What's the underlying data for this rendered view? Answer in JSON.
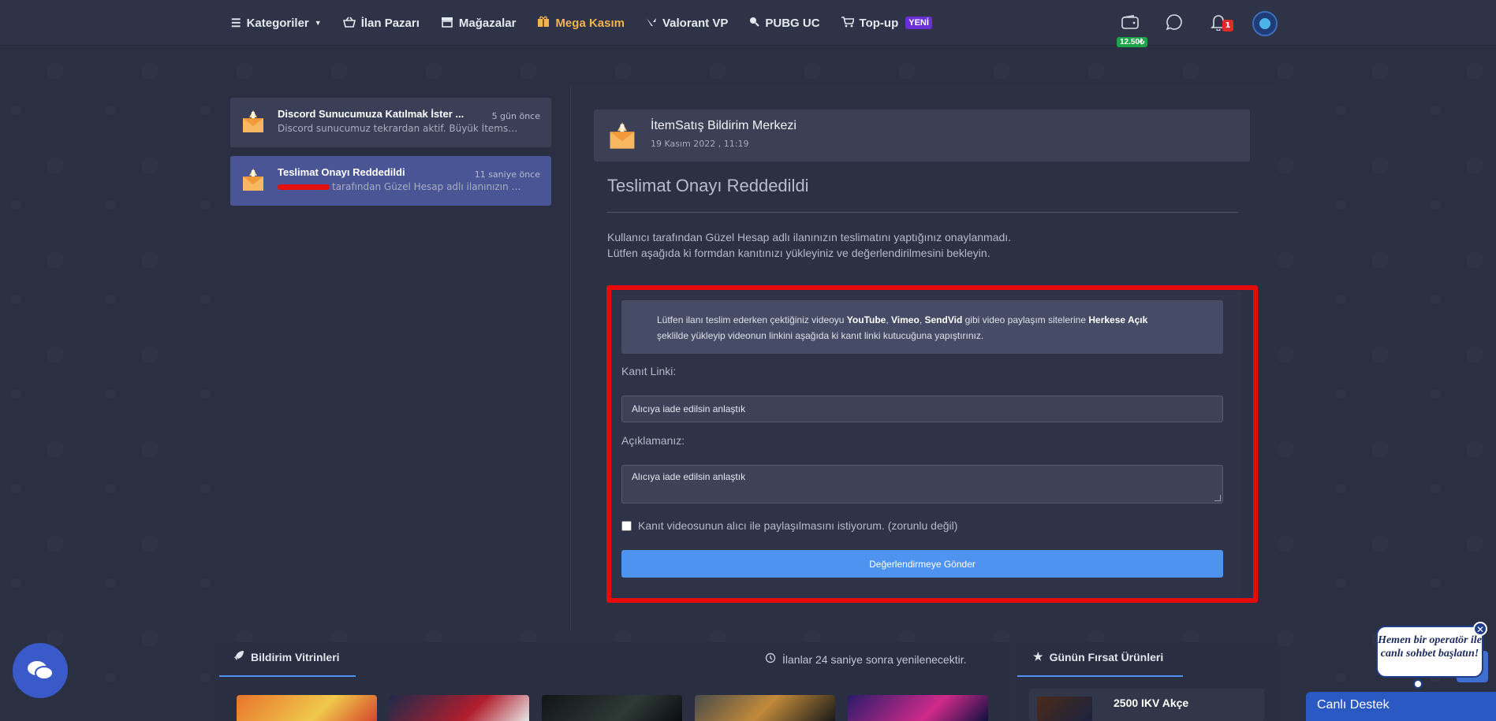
{
  "nav": {
    "items": [
      {
        "label": "Kategoriler",
        "icon": "list-icon",
        "has_dropdown": true
      },
      {
        "label": "İlan Pazarı",
        "icon": "basket-icon"
      },
      {
        "label": "Mağazalar",
        "icon": "store-icon"
      },
      {
        "label": "Mega Kasım",
        "icon": "gift-icon",
        "highlight": true
      },
      {
        "label": "Valorant VP",
        "icon": "valorant-icon"
      },
      {
        "label": "PUBG UC",
        "icon": "pubg-icon"
      },
      {
        "label": "Top-up",
        "icon": "cart-icon",
        "badge": "YENİ"
      }
    ],
    "wallet_amount": "12.50₺",
    "notification_count": "1",
    "highlight_color": "#f0b450"
  },
  "sidebar": {
    "messages": [
      {
        "title": "Discord Sunucumuza Katılmak İster ...",
        "time": "5 gün önce",
        "snippet": "Discord sunucumuz tekrardan aktif. Büyük İtemsat...",
        "active": false
      },
      {
        "title": "Teslimat Onayı Reddedildi",
        "time": "11 saniye önce",
        "snippet": "tarafından Güzel Hesap adlı ilanınızın t...",
        "active": true
      }
    ]
  },
  "notification": {
    "sender": "İtemSatış Bildirim Merkezi",
    "date": "19 Kasım 2022 , 11:19",
    "title": "Teslimat Onayı Reddedildi",
    "desc_line1": "Kullanıcı tarafından Güzel Hesap adlı ilanınızın teslimatını yaptığınız onaylanmadı.",
    "desc_line2": "Lütfen aşağıda ki formdan kanıtınızı yükleyiniz ve değerlendirilmesini bekleyin."
  },
  "form": {
    "info_prefix": "Lütfen ilanı teslim ederken çektiğiniz videoyu ",
    "info_yt": "YouTube",
    "info_sep1": ", ",
    "info_vimeo": "Vimeo",
    "info_sep2": ", ",
    "info_sendvid": "SendVid",
    "info_mid": " gibi video paylaşım sitelerine ",
    "info_public": "Herkese Açık",
    "info_suffix": "şeklilde yükleyip videonun linkini aşağıda ki kanıt linki kutucuğuna yapıştırınız.",
    "proof_label": "Kanıt Linki:",
    "proof_value": "Alıcıya iade edilsin anlaştık",
    "explain_label": "Açıklamanız:",
    "explain_value": "Alıcıya iade edilsin anlaştık",
    "checkbox_label": "Kanıt videosunun alıcı ile paylaşılmasını istiyorum. (zorunlu değil)",
    "submit_label": "Değerlendirmeye Gönder",
    "accent_color": "#4f93f0",
    "annotation_color": "#e50b0b"
  },
  "bottom": {
    "showcase_title": "Bildirim Vitrinleri",
    "refresh_note": "İlanlar 24 saniye sonra yenilenecektir.",
    "deals_title": "Günün Fırsat Ürünleri",
    "deal_product": "2500 IKV Akçe"
  },
  "support": {
    "operator_text": "Hemen bir operatör ile canlı sohbet başlatın!",
    "live_support_label": "Canlı Destek"
  }
}
